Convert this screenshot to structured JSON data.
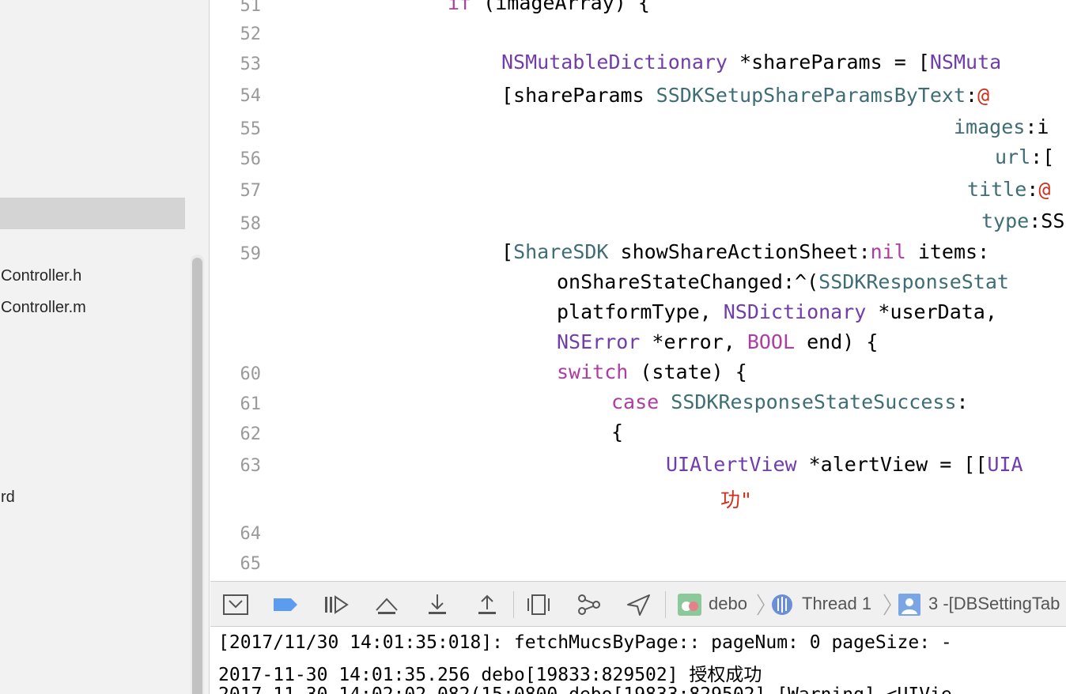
{
  "navigator": {
    "items": [
      "Controller.h",
      "Controller.m",
      "rd"
    ]
  },
  "editor": {
    "line_numbers": [
      "51",
      "52",
      "53",
      "54",
      "55",
      "56",
      "57",
      "58",
      "59",
      "60",
      "61",
      "62",
      "63",
      "64",
      "65"
    ],
    "lines": {
      "l51_kw": "if",
      "l51_rest": " (imageArray) {",
      "l53_cls": "NSMutableDictionary",
      "l53_mid": " *shareParams = [",
      "l53_cls2": "NSMuta",
      "l54_a": "[shareParams ",
      "l54_mth": "SSDKSetupShareParamsByText",
      "l54_b": ":",
      "l54_str": "@",
      "l55_mth": "images",
      "l55_rest": ":i",
      "l56_mth": "url",
      "l56_rest": ":[",
      "l57_mth": "title",
      "l57_b": ":",
      "l57_str": "@",
      "l58_mth": "type",
      "l58_rest": ":SS",
      "l59_a": "[",
      "l59_cls": "ShareSDK",
      "l59_mth": " showShareActionSheet",
      "l59_b": ":",
      "l59_kw": "nil",
      "l59_mth2": " items",
      "l59_c": ":",
      "l59w1_a": "onShareStateChanged",
      "l59w1_b": ":^(",
      "l59w1_cls": "SSDKResponseStat",
      "l59w2_a": "platformType, ",
      "l59w2_cls": "NSDictionary",
      "l59w2_b": " *userData,",
      "l59w3_cls": "NSError",
      "l59w3_a": " *error, ",
      "l59w3_kw": "BOOL",
      "l59w3_b": " end) {",
      "l60_kw": "switch",
      "l60_rest": " (state) {",
      "l61_kw": "case",
      "l61_mth": " SSDKResponseStateSuccess",
      "l61_rest": ":",
      "l62": "{",
      "l63_cls": "UIAlertView",
      "l63_a": " *alertView = [[",
      "l63_cls2": "UIA",
      "l63w_str": "功\""
    }
  },
  "debug_bar": {
    "process": "debo",
    "thread": "Thread 1",
    "frame": "3 -[DBSettingTab",
    "accent_color": "#5b9bf0"
  },
  "console": {
    "lines": [
      "[2017/11/30 14:01:35:018]: fetchMucsByPage:: pageNum: 0 pageSize: -",
      "2017-11-30 14:01:35.256 debo[19833:829502] 授权成功",
      "2017-11-30 14:02:02.082(15:0800 debo[19833:829502] [Warning] <UIVie"
    ]
  }
}
